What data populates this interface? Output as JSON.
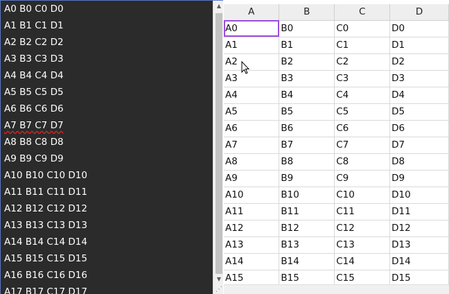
{
  "editor": {
    "lines": [
      "A0 B0 C0 D0",
      "A1 B1 C1 D1",
      "A2 B2 C2 D2",
      "A3 B3 C3 D3",
      "A4 B4 C4 D4",
      "A5 B5 C5 D5",
      "A6 B6 C6 D6",
      "A7 B7 C7 D7",
      "A8 B8 C8 D8",
      "A9 B9 C9 D9",
      "A10 B10 C10 D10",
      "A11 B11 C11 D11",
      "A12 B12 C12 D12",
      "A13 B13 C13 D13",
      "A14 B14 C14 D14",
      "A15 B15 C15 D15",
      "A16 B16 C16 D16",
      "A17 B17 C17 D17"
    ],
    "scroll_up_icon": "triangle-up",
    "scroll_down_icon": "triangle-down"
  },
  "grid": {
    "columns": [
      "A",
      "B",
      "C",
      "D"
    ],
    "rows": [
      [
        "A0",
        "B0",
        "C0",
        "D0"
      ],
      [
        "A1",
        "B1",
        "C1",
        "D1"
      ],
      [
        "A2",
        "B2",
        "C2",
        "D2"
      ],
      [
        "A3",
        "B3",
        "C3",
        "D3"
      ],
      [
        "A4",
        "B4",
        "C4",
        "D4"
      ],
      [
        "A5",
        "B5",
        "C5",
        "D5"
      ],
      [
        "A6",
        "B6",
        "C6",
        "D6"
      ],
      [
        "A7",
        "B7",
        "C7",
        "D7"
      ],
      [
        "A8",
        "B8",
        "C8",
        "D8"
      ],
      [
        "A9",
        "B9",
        "C9",
        "D9"
      ],
      [
        "A10",
        "B10",
        "C10",
        "D10"
      ],
      [
        "A11",
        "B11",
        "C11",
        "D11"
      ],
      [
        "A12",
        "B12",
        "C12",
        "D12"
      ],
      [
        "A13",
        "B13",
        "C13",
        "D13"
      ],
      [
        "A14",
        "B14",
        "C14",
        "D14"
      ],
      [
        "A15",
        "B15",
        "C15",
        "D15"
      ]
    ],
    "selected_cell": "A0",
    "selection_color": "#9b4dde"
  }
}
